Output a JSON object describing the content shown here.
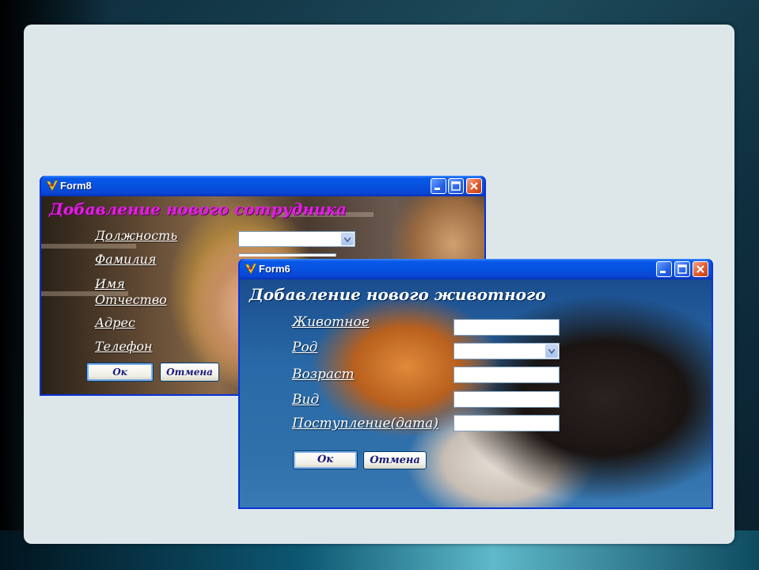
{
  "form8": {
    "title": "Form8",
    "heading": "Добавление нового сотрудника",
    "labels": [
      "Должность",
      "Фамилия",
      "Имя",
      "Отчество",
      "Адрес",
      "Телефон"
    ],
    "ok_label": "Ок",
    "cancel_label": "Отмена"
  },
  "form6": {
    "title": "Form6",
    "heading": "Добавление нового животного",
    "labels": [
      "Животное",
      "Род",
      "Возраст",
      "Вид",
      "Поступление(дата)"
    ],
    "ok_label": "Ок",
    "cancel_label": "Отмена"
  },
  "colors": {
    "title_bar": "#0553e0",
    "form8_heading": "#e020e0",
    "close_button": "#e25a2e"
  }
}
